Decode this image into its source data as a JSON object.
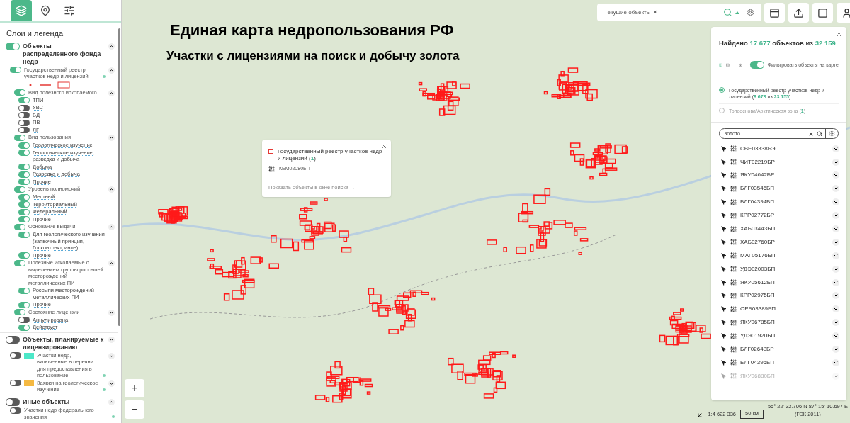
{
  "sidebar": {
    "tabs": [
      {
        "kind": "layers",
        "selected": true
      },
      {
        "kind": "pin",
        "selected": false
      },
      {
        "kind": "sliders",
        "selected": false
      }
    ],
    "title": "Слои и легенда",
    "layers": [
      {
        "label": "Объекты распределенного фонда недр",
        "on": true,
        "expanded": true,
        "children": [
          {
            "label": "Государственный реестр участков недр и лицензий",
            "on": true,
            "expanded": true,
            "info": true,
            "legend": true,
            "children": [
              {
                "label": "Вид полезного ископаемого",
                "on": true,
                "expanded": true,
                "children": [
                  {
                    "label": "ТПИ",
                    "on": true
                  },
                  {
                    "label": "УВС",
                    "on": false
                  },
                  {
                    "label": "БД",
                    "on": false
                  },
                  {
                    "label": "ПВ",
                    "on": false
                  },
                  {
                    "label": "ЛГ",
                    "on": false
                  }
                ]
              },
              {
                "label": "Вид пользования",
                "on": true,
                "expanded": true,
                "children": [
                  {
                    "label": "Геологическое изучение",
                    "on": true
                  },
                  {
                    "label": "Геологическое изучение, разведка и добыча",
                    "on": true
                  },
                  {
                    "label": "Добыча",
                    "on": true
                  },
                  {
                    "label": "Разведка и добыча",
                    "on": true
                  },
                  {
                    "label": "Прочие",
                    "on": true
                  }
                ]
              },
              {
                "label": "Уровень полномочий",
                "on": true,
                "expanded": true,
                "children": [
                  {
                    "label": "Местный",
                    "on": true
                  },
                  {
                    "label": "Территориальный",
                    "on": true
                  },
                  {
                    "label": "Федеральный",
                    "on": true
                  },
                  {
                    "label": "Прочие",
                    "on": true
                  }
                ]
              },
              {
                "label": "Основание выдачи",
                "on": true,
                "expanded": true,
                "children": [
                  {
                    "label": "Для геологического изучения (заявочный принцип, Госконтракт, иное)",
                    "on": true
                  },
                  {
                    "label": "Прочие",
                    "on": true
                  }
                ]
              },
              {
                "label": "Полезные ископаемые с выделением группы россыпей месторождений металлических ПИ",
                "on": true,
                "expanded": true,
                "children": [
                  {
                    "label": "Россыпи месторождений металлических ПИ",
                    "on": true
                  },
                  {
                    "label": "Прочие",
                    "on": true
                  }
                ]
              },
              {
                "label": "Состояние лицензии",
                "on": true,
                "expanded": true,
                "children": [
                  {
                    "label": "Аннулирована",
                    "on": false
                  },
                  {
                    "label": "Действует",
                    "on": true
                  }
                ]
              }
            ]
          }
        ]
      },
      {
        "label": "Объекты, планируемые к лицензированию",
        "on": false,
        "expanded": true,
        "children": [
          {
            "label": "Участки недр, включенные в перечни для предоставления в пользование",
            "on": false,
            "expanded": false,
            "info": true,
            "color": "#4de8c8"
          },
          {
            "label": "Заявки на геологическое изучение",
            "on": false,
            "expanded": false,
            "info": true,
            "color": "#f5b942"
          }
        ]
      },
      {
        "label": "Иные объекты",
        "on": false,
        "expanded": true,
        "children": [
          {
            "label": "Участки недр федерального значения",
            "on": false,
            "info": true
          }
        ]
      }
    ]
  },
  "map": {
    "captions": [
      "Единая карта недропользования РФ",
      "Участки с лицензиями на поиск и добычу золота"
    ],
    "zoom_in": "+",
    "zoom_out": "−",
    "scale_ratio": "1:4 622 336",
    "scale_bar": "50 км",
    "coordinates": "55° 22' 32.706 N 87° 15' 10.697 E",
    "datum": "(ГСК 2011)"
  },
  "popup": {
    "layer": "Государственный реестр участков недр и лицензий (**1**)",
    "code": "КЕМ02080БП",
    "link": "Показать объекты в окне поиска →"
  },
  "topbar": {
    "chip": "Текущие объекты",
    "chip_close": "×"
  },
  "results": {
    "header": "Найдено **17 677** объектов из **32 159**",
    "filter_label": "Фильтровать объекты на карте",
    "filter_on": true,
    "layers": [
      {
        "label": "Государственный реестр участков недр и лицензий",
        "count": "(**8 673** из **23 155**)",
        "selected": true
      },
      {
        "label": "Топооснова/Арктическая зона",
        "count": "(**1**)",
        "selected": false
      }
    ],
    "search": {
      "value": "золото"
    },
    "items": [
      {
        "code": "СВЕ03338БЭ",
        "faded": false
      },
      {
        "code": "ЧИТ02219БР",
        "faded": false
      },
      {
        "code": "ЯКУ04642БР",
        "faded": false
      },
      {
        "code": "БЛГ03546БП",
        "faded": false
      },
      {
        "code": "БЛГ04394БП",
        "faded": false
      },
      {
        "code": "КРР02772БР",
        "faded": false
      },
      {
        "code": "ХАБ03443БП",
        "faded": false
      },
      {
        "code": "ХАБ02760БР",
        "faded": false
      },
      {
        "code": "МАГ05176БП",
        "faded": false
      },
      {
        "code": "УДЭ02003БП",
        "faded": false
      },
      {
        "code": "ЯКУ05612БП",
        "faded": false
      },
      {
        "code": "КРР02975БП",
        "faded": false
      },
      {
        "code": "ОРБ03389БП",
        "faded": false
      },
      {
        "code": "ЯКУ06785БП",
        "faded": false
      },
      {
        "code": "УДЭ01920БП",
        "faded": false
      },
      {
        "code": "БЛГ02648БР",
        "faded": false
      },
      {
        "code": "БЛГ04395БП",
        "faded": false
      },
      {
        "code": "ЯКУ06880БП",
        "faded": true
      }
    ]
  }
}
